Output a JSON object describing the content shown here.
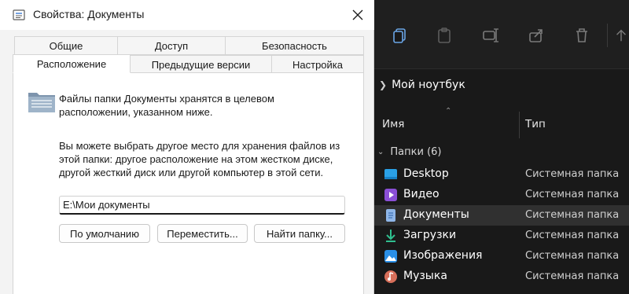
{
  "dialog": {
    "title": "Свойства: Документы",
    "tabs_row1": [
      "Общие",
      "Доступ",
      "Безопасность"
    ],
    "tabs_row2": [
      "Расположение",
      "Предыдущие версии",
      "Настройка"
    ],
    "active_tab": "Расположение",
    "info_text": "Файлы папки Документы хранятся в целевом расположении, указанном ниже.",
    "help_text": "Вы можете выбрать другое место для хранения файлов из этой папки: другое расположение на этом жестком диске, другой жесткий диск или другой компьютер в этой сети.",
    "path_value": "E:\\Мои документы",
    "buttons": {
      "default": "По умолчанию",
      "move": "Переместить...",
      "find": "Найти папку..."
    }
  },
  "explorer": {
    "address": "Мой ноутбук",
    "columns": {
      "name": "Имя",
      "type": "Тип"
    },
    "group_label": "Папки (6)",
    "items": [
      {
        "name": "Desktop",
        "type": "Системная папка",
        "icon": "desktop-icon",
        "selected": false
      },
      {
        "name": "Видео",
        "type": "Системная папка",
        "icon": "video-icon",
        "selected": false
      },
      {
        "name": "Документы",
        "type": "Системная папка",
        "icon": "document-icon",
        "selected": true
      },
      {
        "name": "Загрузки",
        "type": "Системная папка",
        "icon": "download-icon",
        "selected": false
      },
      {
        "name": "Изображения",
        "type": "Системная папка",
        "icon": "image-icon",
        "selected": false
      },
      {
        "name": "Музыка",
        "type": "Системная папка",
        "icon": "music-icon",
        "selected": false
      }
    ],
    "toolbar_icons": [
      "copy-icon",
      "paste-icon",
      "rename-icon",
      "share-icon",
      "delete-icon"
    ]
  }
}
